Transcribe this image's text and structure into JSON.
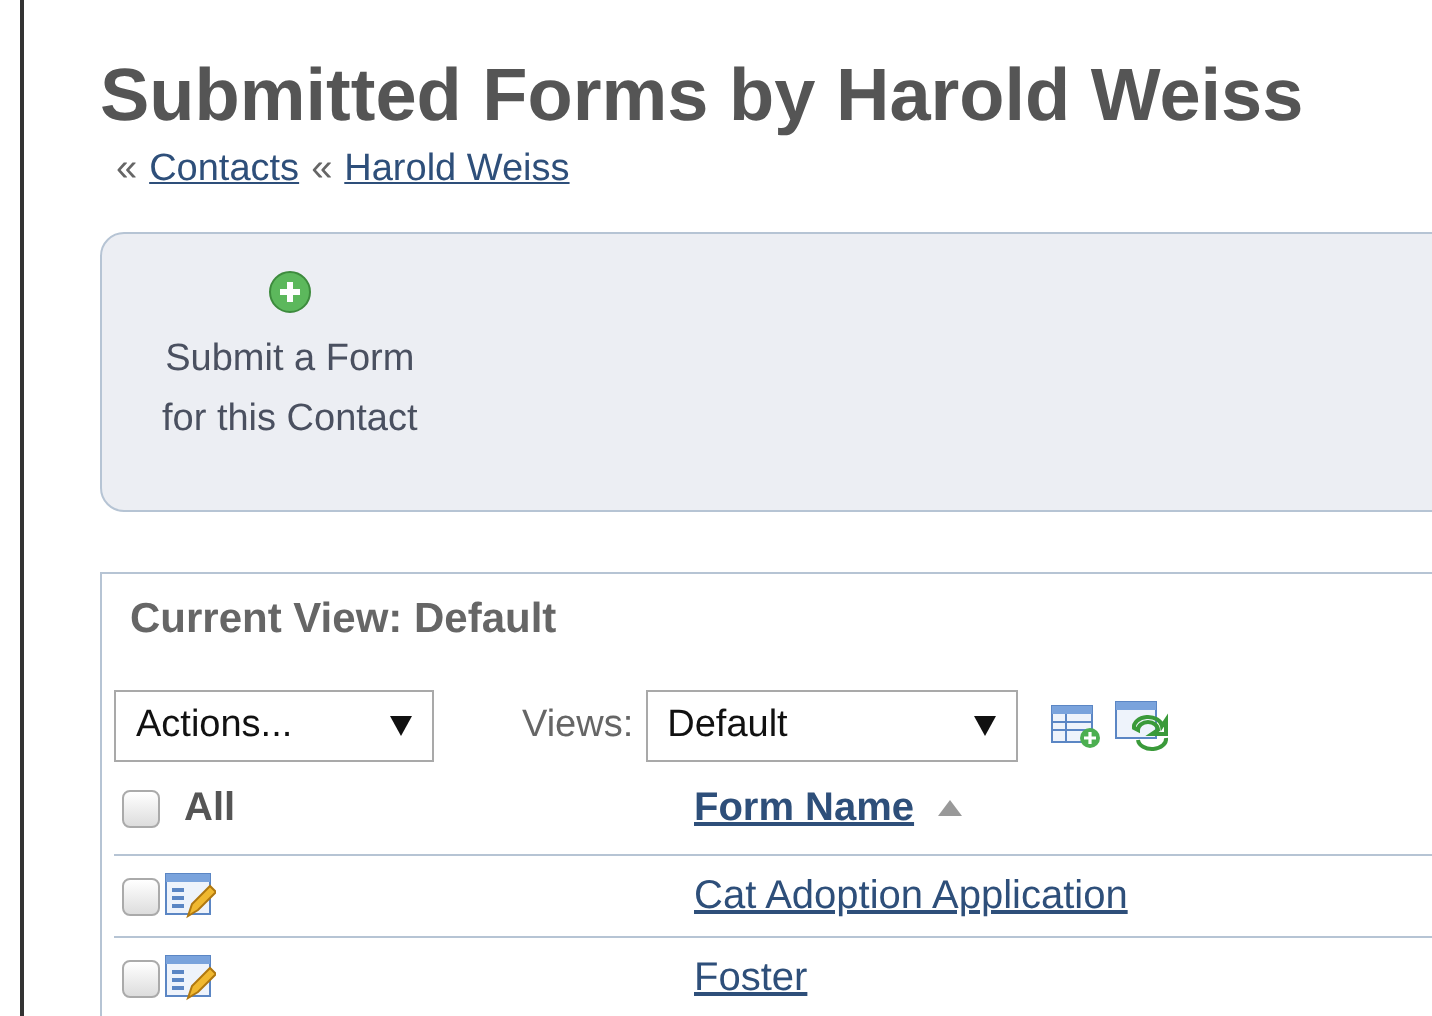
{
  "page_title": "Submitted Forms by Harold Weiss",
  "breadcrumbs": [
    {
      "separator": "«",
      "label": "Contacts"
    },
    {
      "separator": "«",
      "label": "Harold Weiss"
    }
  ],
  "toolbar": {
    "buttons": [
      {
        "label_lines": [
          "Submit a Form",
          "for this Contact"
        ]
      }
    ]
  },
  "view_panel": {
    "title": "Current View: Default",
    "actions_select": {
      "value": "Actions..."
    },
    "views_label": "Views:",
    "views_select": {
      "value": "Default"
    },
    "table": {
      "select_all": {
        "label": "All",
        "checked": false
      },
      "columns": [
        {
          "label": "Form Name",
          "sort_ascending": true
        }
      ],
      "rows": [
        {
          "checked": false,
          "form_name": "Cat Adoption Application"
        },
        {
          "checked": false,
          "form_name": "Foster"
        }
      ]
    }
  }
}
